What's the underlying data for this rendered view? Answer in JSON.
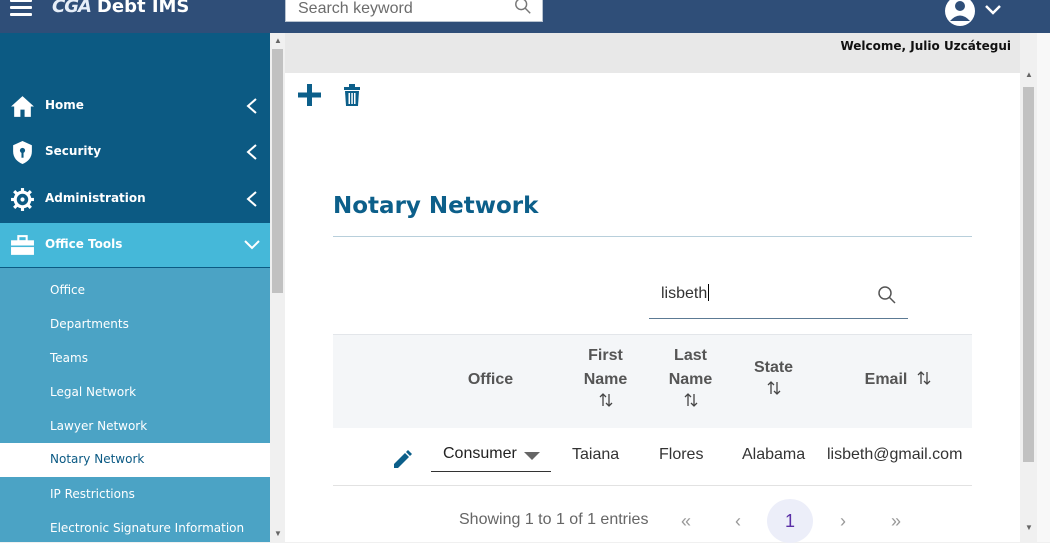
{
  "app": {
    "logo_mark": "CGA",
    "title": "Debt IMS"
  },
  "search": {
    "placeholder": "Search keyword"
  },
  "header": {
    "welcome": "Welcome, Julio Uzcátegui"
  },
  "sidebar": {
    "nav": [
      {
        "label": "Home",
        "icon": "home-icon"
      },
      {
        "label": "Security",
        "icon": "shield-icon"
      },
      {
        "label": "Administration",
        "icon": "gear-icon"
      },
      {
        "label": "Office Tools",
        "icon": "briefcase-icon"
      }
    ],
    "subitems": [
      "Office",
      "Departments",
      "Teams",
      "Legal Network",
      "Lawyer Network",
      "Notary Network",
      "IP Restrictions",
      "Electronic Signature Information"
    ],
    "active": "Notary Network"
  },
  "page": {
    "title": "Notary Network",
    "table_search_value": "lisbeth"
  },
  "table": {
    "columns": [
      {
        "line1": "Office",
        "line2": ""
      },
      {
        "line1": "First",
        "line2": "Name"
      },
      {
        "line1": "Last",
        "line2": "Name"
      },
      {
        "line1": "State",
        "line2": ""
      },
      {
        "line1": "Email",
        "line2": ""
      }
    ],
    "rows": [
      {
        "office": "Consumer",
        "first_name": "Taiana",
        "last_name": "Flores",
        "state": "Alabama",
        "email": "lisbeth@gmail.com"
      }
    ]
  },
  "pagination": {
    "info": "Showing 1 to 1 of 1 entries",
    "first": "«",
    "prev": "‹",
    "current": "1",
    "next": "›",
    "last": "»"
  },
  "colors": {
    "topbar": "#2f4e78",
    "sidebar_dark": "#0c5a83",
    "sidebar_light": "#4ba3c5",
    "accent": "#0c5f8a"
  }
}
